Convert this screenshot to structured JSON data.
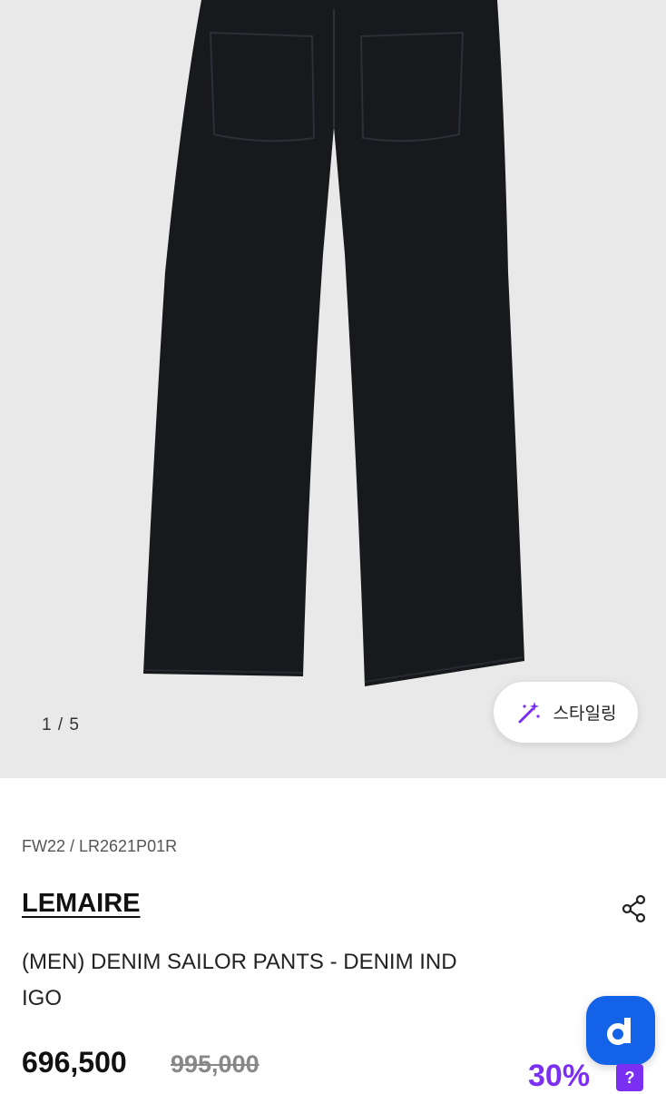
{
  "gallery": {
    "counter": "1 / 5",
    "styling_button_label": "스타일링",
    "wand_icon": "magic-wand-sparkle-icon"
  },
  "product": {
    "meta": "FW22 / LR2621P01R",
    "brand": "LEMAIRE",
    "title_line1": "(MEN) DENIM SAILOR PANTS - DENIM IND",
    "title_line2": "IGO",
    "price": "696,500",
    "original_price": "995,000",
    "discount": "30%",
    "help_badge": "?"
  },
  "icons": {
    "share": "share-icon",
    "app": "d-logo-icon"
  },
  "colors": {
    "accent": "#7b2ff2",
    "fab": "#1462e8",
    "gallery_bg": "#e9e9ea"
  }
}
